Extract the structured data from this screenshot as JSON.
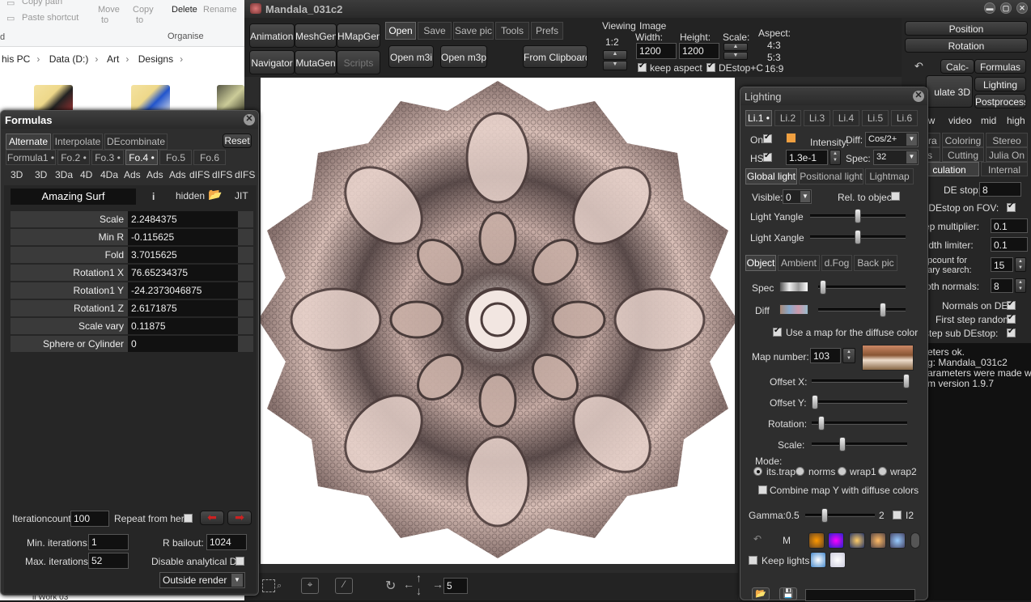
{
  "explorer": {
    "ribbon": {
      "paste_path": "Copy path",
      "paste_shortcut": "Paste shortcut",
      "move_to": "Move",
      "move_to2": "to",
      "copy_to": "Copy",
      "copy_to2": "to",
      "delete": "Delete",
      "rename": "Rename",
      "group": "Organise",
      "left_frag": "d"
    },
    "breadcrumb": [
      "his PC",
      "Data (D:)",
      "Art",
      "Designs"
    ],
    "bottom_frag": "ll Work 03"
  },
  "app": {
    "title": "Mandala_031c2",
    "buttons": {
      "animations": "Animations",
      "meshgen": "MeshGen",
      "hmapgen": "HMapGen",
      "navigator": "Navigator",
      "mutagen": "MutaGen",
      "scripts": "Scripts"
    },
    "menu_tabs": [
      "Open",
      "Save",
      "Save pic",
      "Tools",
      "Prefs"
    ],
    "open_m3i": "Open m3i",
    "open_m3p": "Open m3p",
    "from_clipboard": "From Clipboard",
    "viewing_label": "Viewing",
    "viewing_ratio": "1:2",
    "image_label": "Image",
    "width_label": "Width:",
    "height_label": "Height:",
    "scale_label": "Scale:",
    "width_value": "1200",
    "height_value": "1200",
    "aspect_label": "Aspect:",
    "aspects": [
      "4:3",
      "5:3",
      "16:9"
    ],
    "keep_aspect": "keep aspect",
    "destop_c": "DEstop+C",
    "bottom_value": "5"
  },
  "right_panel": {
    "position": "Position",
    "rotation": "Rotation",
    "calc": "Calc-",
    "formulas": "Formulas",
    "lighting": "Lighting",
    "postprocess": "Postprocess",
    "calc3d": "ulate 3D",
    "row1": [
      "ew",
      "video",
      "mid",
      "high"
    ],
    "row2": [
      "era",
      "Coloring",
      "Stereo"
    ],
    "row3": [
      "s",
      "Cutting",
      "Julia On"
    ],
    "tabs": [
      "culation",
      "Internal"
    ],
    "de_stop_label": "DE stop:",
    "de_stop_value": "8",
    "destop_fov": "ry DEstop on FOV:",
    "step_mult_label": "ep multiplier:",
    "step_mult_value": "0.1",
    "width_limiter_label": "width limiter:",
    "width_limiter_value": "0.1",
    "stepcount_label1": "epcount for",
    "stepcount_label2": "nary search:",
    "stepcount_value": "15",
    "smooth_normals_label": "oth normals:",
    "smooth_normals_value": "8",
    "normals_de": "Normals on DE:",
    "first_step_random": "First step random:",
    "stepsub": "ystep sub DEstop:",
    "log": [
      "eters ok.",
      "g: Mandala_031c2",
      "arameters were made with",
      "m version 1.9.7"
    ]
  },
  "formulas": {
    "title": "Formulas",
    "tabs": [
      "Alternate",
      "Interpolate",
      "DEcombinate"
    ],
    "reset": "Reset",
    "formula_tabs": [
      "Formula1 •",
      "Fo.2 •",
      "Fo.3 •",
      "Fo.4 •",
      "Fo.5",
      "Fo.6"
    ],
    "categories": [
      "3D",
      "3D",
      "3Da",
      "4D",
      "4Da",
      "Ads",
      "Ads",
      "Ads",
      "dIFS",
      "dIFS",
      "dIFS"
    ],
    "formula_name": "Amazing Surf",
    "info": "i",
    "hidden": "hidden",
    "jit": "JIT",
    "params": [
      {
        "label": "Scale",
        "value": "2.2484375"
      },
      {
        "label": "Min R",
        "value": "-0.115625"
      },
      {
        "label": "Fold",
        "value": "3.7015625"
      },
      {
        "label": "Rotation1 X",
        "value": "76.65234375"
      },
      {
        "label": "Rotation1 Y",
        "value": "-24.2373046875"
      },
      {
        "label": "Rotation1 Z",
        "value": "2.6171875"
      },
      {
        "label": "Scale vary",
        "value": "0.11875"
      },
      {
        "label": "Sphere or Cylinder",
        "value": "0"
      }
    ],
    "iterationcount_label": "Iterationcount",
    "iterationcount_value": "100",
    "repeat_from_here": "Repeat from here",
    "min_iter_label": "Min. iterations:",
    "min_iter_value": "1",
    "max_iter_label": "Max. iterations:",
    "max_iter_value": "52",
    "r_bailout_label": "R bailout:",
    "r_bailout_value": "1024",
    "disable_de": "Disable analytical DE",
    "outside_render": "Outside render"
  },
  "lighting": {
    "title": "Lighting",
    "light_tabs": [
      "Li.1 •",
      "Li.2",
      "Li.3",
      "Li.4",
      "Li.5",
      "Li.6"
    ],
    "on": "On",
    "intensity": "Intensity:",
    "diff": "Diff:",
    "diff_value": "Cos/2+",
    "hs": "HS",
    "hs_value": "1.3e-1",
    "spec": "Spec:",
    "spec_value": "32",
    "tabs1": [
      "Global light",
      "Positional light",
      "Lightmap"
    ],
    "visible": "Visible:",
    "visible_value": "0",
    "rel_to_object": "Rel. to object:",
    "y_angle": "Light Yangle",
    "x_angle": "Light Xangle",
    "tabs2": [
      "Object",
      "Ambient",
      "d.Fog",
      "Back pic"
    ],
    "spec_label": "Spec",
    "diff_label": "Diff",
    "use_map": "Use a map for the diffuse color",
    "map_number_label": "Map number:",
    "map_number_value": "103",
    "offset_x": "Offset X:",
    "offset_y": "Offset Y:",
    "rotation": "Rotation:",
    "scale": "Scale:",
    "mode": "Mode:",
    "modes": [
      "its.trap",
      "norms",
      "wrap1",
      "wrap2"
    ],
    "combine": "Combine map Y with diffuse colors",
    "gamma_label": "Gamma:",
    "gamma_min": "0.5",
    "gamma_max": "2",
    "i2": "I2",
    "m_label": "M",
    "keep_lights": "Keep lights"
  },
  "colors": {
    "accent_orange": "#f0a040",
    "arrow_red": "#cc2222"
  }
}
